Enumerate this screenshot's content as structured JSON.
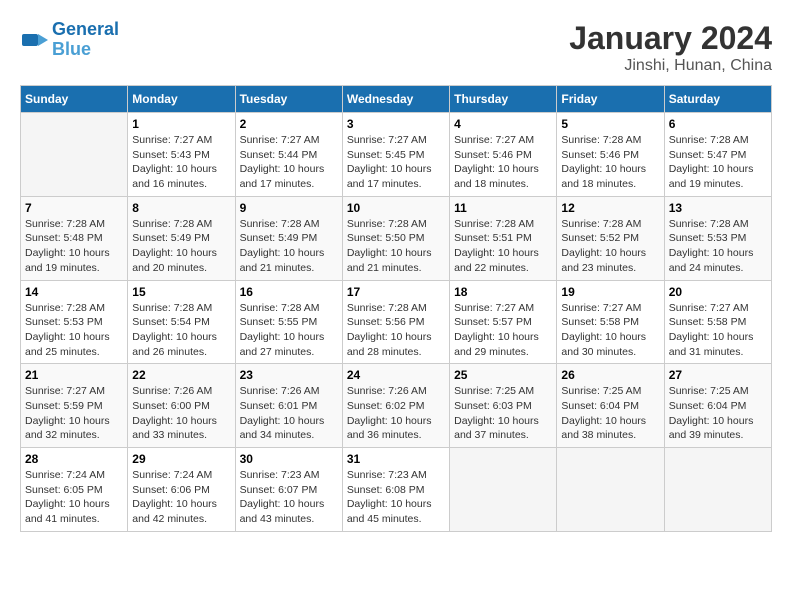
{
  "header": {
    "logo_line1": "General",
    "logo_line2": "Blue",
    "title": "January 2024",
    "subtitle": "Jinshi, Hunan, China"
  },
  "days_of_week": [
    "Sunday",
    "Monday",
    "Tuesday",
    "Wednesday",
    "Thursday",
    "Friday",
    "Saturday"
  ],
  "weeks": [
    [
      {
        "date": "",
        "info": ""
      },
      {
        "date": "1",
        "info": "Sunrise: 7:27 AM\nSunset: 5:43 PM\nDaylight: 10 hours\nand 16 minutes."
      },
      {
        "date": "2",
        "info": "Sunrise: 7:27 AM\nSunset: 5:44 PM\nDaylight: 10 hours\nand 17 minutes."
      },
      {
        "date": "3",
        "info": "Sunrise: 7:27 AM\nSunset: 5:45 PM\nDaylight: 10 hours\nand 17 minutes."
      },
      {
        "date": "4",
        "info": "Sunrise: 7:27 AM\nSunset: 5:46 PM\nDaylight: 10 hours\nand 18 minutes."
      },
      {
        "date": "5",
        "info": "Sunrise: 7:28 AM\nSunset: 5:46 PM\nDaylight: 10 hours\nand 18 minutes."
      },
      {
        "date": "6",
        "info": "Sunrise: 7:28 AM\nSunset: 5:47 PM\nDaylight: 10 hours\nand 19 minutes."
      }
    ],
    [
      {
        "date": "7",
        "info": "Sunrise: 7:28 AM\nSunset: 5:48 PM\nDaylight: 10 hours\nand 19 minutes."
      },
      {
        "date": "8",
        "info": "Sunrise: 7:28 AM\nSunset: 5:49 PM\nDaylight: 10 hours\nand 20 minutes."
      },
      {
        "date": "9",
        "info": "Sunrise: 7:28 AM\nSunset: 5:49 PM\nDaylight: 10 hours\nand 21 minutes."
      },
      {
        "date": "10",
        "info": "Sunrise: 7:28 AM\nSunset: 5:50 PM\nDaylight: 10 hours\nand 21 minutes."
      },
      {
        "date": "11",
        "info": "Sunrise: 7:28 AM\nSunset: 5:51 PM\nDaylight: 10 hours\nand 22 minutes."
      },
      {
        "date": "12",
        "info": "Sunrise: 7:28 AM\nSunset: 5:52 PM\nDaylight: 10 hours\nand 23 minutes."
      },
      {
        "date": "13",
        "info": "Sunrise: 7:28 AM\nSunset: 5:53 PM\nDaylight: 10 hours\nand 24 minutes."
      }
    ],
    [
      {
        "date": "14",
        "info": "Sunrise: 7:28 AM\nSunset: 5:53 PM\nDaylight: 10 hours\nand 25 minutes."
      },
      {
        "date": "15",
        "info": "Sunrise: 7:28 AM\nSunset: 5:54 PM\nDaylight: 10 hours\nand 26 minutes."
      },
      {
        "date": "16",
        "info": "Sunrise: 7:28 AM\nSunset: 5:55 PM\nDaylight: 10 hours\nand 27 minutes."
      },
      {
        "date": "17",
        "info": "Sunrise: 7:28 AM\nSunset: 5:56 PM\nDaylight: 10 hours\nand 28 minutes."
      },
      {
        "date": "18",
        "info": "Sunrise: 7:27 AM\nSunset: 5:57 PM\nDaylight: 10 hours\nand 29 minutes."
      },
      {
        "date": "19",
        "info": "Sunrise: 7:27 AM\nSunset: 5:58 PM\nDaylight: 10 hours\nand 30 minutes."
      },
      {
        "date": "20",
        "info": "Sunrise: 7:27 AM\nSunset: 5:58 PM\nDaylight: 10 hours\nand 31 minutes."
      }
    ],
    [
      {
        "date": "21",
        "info": "Sunrise: 7:27 AM\nSunset: 5:59 PM\nDaylight: 10 hours\nand 32 minutes."
      },
      {
        "date": "22",
        "info": "Sunrise: 7:26 AM\nSunset: 6:00 PM\nDaylight: 10 hours\nand 33 minutes."
      },
      {
        "date": "23",
        "info": "Sunrise: 7:26 AM\nSunset: 6:01 PM\nDaylight: 10 hours\nand 34 minutes."
      },
      {
        "date": "24",
        "info": "Sunrise: 7:26 AM\nSunset: 6:02 PM\nDaylight: 10 hours\nand 36 minutes."
      },
      {
        "date": "25",
        "info": "Sunrise: 7:25 AM\nSunset: 6:03 PM\nDaylight: 10 hours\nand 37 minutes."
      },
      {
        "date": "26",
        "info": "Sunrise: 7:25 AM\nSunset: 6:04 PM\nDaylight: 10 hours\nand 38 minutes."
      },
      {
        "date": "27",
        "info": "Sunrise: 7:25 AM\nSunset: 6:04 PM\nDaylight: 10 hours\nand 39 minutes."
      }
    ],
    [
      {
        "date": "28",
        "info": "Sunrise: 7:24 AM\nSunset: 6:05 PM\nDaylight: 10 hours\nand 41 minutes."
      },
      {
        "date": "29",
        "info": "Sunrise: 7:24 AM\nSunset: 6:06 PM\nDaylight: 10 hours\nand 42 minutes."
      },
      {
        "date": "30",
        "info": "Sunrise: 7:23 AM\nSunset: 6:07 PM\nDaylight: 10 hours\nand 43 minutes."
      },
      {
        "date": "31",
        "info": "Sunrise: 7:23 AM\nSunset: 6:08 PM\nDaylight: 10 hours\nand 45 minutes."
      },
      {
        "date": "",
        "info": ""
      },
      {
        "date": "",
        "info": ""
      },
      {
        "date": "",
        "info": ""
      }
    ]
  ]
}
